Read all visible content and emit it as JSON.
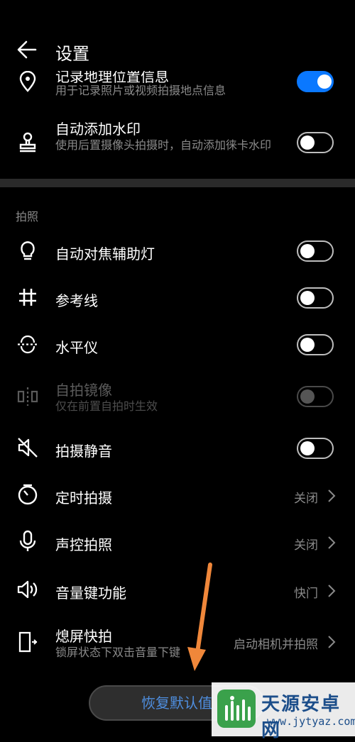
{
  "header": {
    "title": "设置"
  },
  "top_rows": [
    {
      "label": "记录地理位置信息",
      "sub": "用于记录照片或视频拍摄地点信息",
      "toggle": "on"
    },
    {
      "label": "自动添加水印",
      "sub": "使用后置摄像头拍摄时，自动添加徕卡水印",
      "toggle": "off"
    }
  ],
  "section_title": "拍照",
  "rows": [
    {
      "label": "自动对焦辅助灯",
      "toggle": "off"
    },
    {
      "label": "参考线",
      "toggle": "off"
    },
    {
      "label": "水平仪",
      "toggle": "off"
    },
    {
      "label": "自拍镜像",
      "sub": "仅在前置自拍时生效",
      "toggle": "disabled"
    },
    {
      "label": "拍摄静音",
      "toggle": "off"
    },
    {
      "label": "定时拍摄",
      "value": "关闭"
    },
    {
      "label": "声控拍照",
      "value": "关闭"
    },
    {
      "label": "音量键功能",
      "value": "快门"
    },
    {
      "label": "熄屏快拍",
      "sub": "锁屏状态下双击音量下键",
      "value": "启动相机并拍照"
    }
  ],
  "reset_button": "恢复默认值",
  "watermark": {
    "name": "天源安卓网",
    "url": "www.jytyaz.com"
  },
  "colors": {
    "accent": "#0a78ff",
    "arrow": "#f0873a",
    "link": "#4f8fe0"
  },
  "icons": [
    "back-arrow-icon",
    "location-pin-icon",
    "stamp-icon",
    "bulb-icon",
    "grid-icon",
    "level-icon",
    "mirror-icon",
    "mute-speaker-icon",
    "timer-icon",
    "microphone-icon",
    "volume-icon",
    "screen-off-icon",
    "chevron-right-icon"
  ]
}
